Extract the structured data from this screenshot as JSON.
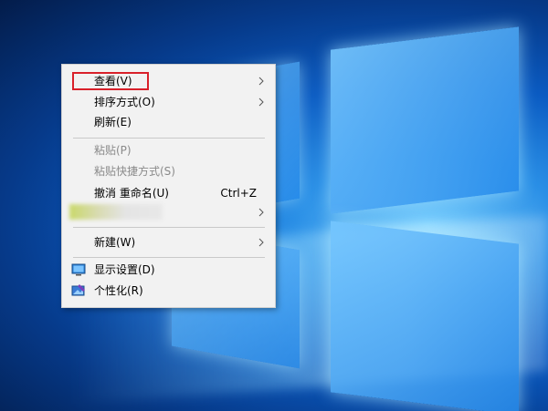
{
  "colors": {
    "menu_background": "#f2f2f2",
    "disabled_text": "#8a8a8a",
    "highlight_border": "#d9202a",
    "desktop_accent": "#0b5bc2"
  },
  "context_menu": {
    "items": [
      {
        "label": "查看(V)",
        "has_submenu": true,
        "enabled": true,
        "highlighted": true
      },
      {
        "label": "排序方式(O)",
        "has_submenu": true,
        "enabled": true
      },
      {
        "label": "刷新(E)",
        "has_submenu": false,
        "enabled": true
      },
      {
        "label": "粘贴(P)",
        "has_submenu": false,
        "enabled": false
      },
      {
        "label": "粘贴快捷方式(S)",
        "has_submenu": false,
        "enabled": false
      },
      {
        "label": "撤消 重命名(U)",
        "shortcut": "Ctrl+Z",
        "has_submenu": false,
        "enabled": true
      },
      {
        "label": "",
        "has_submenu": true,
        "enabled": true,
        "obscured": true
      },
      {
        "label": "新建(W)",
        "has_submenu": true,
        "enabled": true
      },
      {
        "label": "显示设置(D)",
        "icon": "display-icon",
        "has_submenu": false,
        "enabled": true
      },
      {
        "label": "个性化(R)",
        "icon": "personalize-icon",
        "has_submenu": false,
        "enabled": true
      }
    ]
  }
}
